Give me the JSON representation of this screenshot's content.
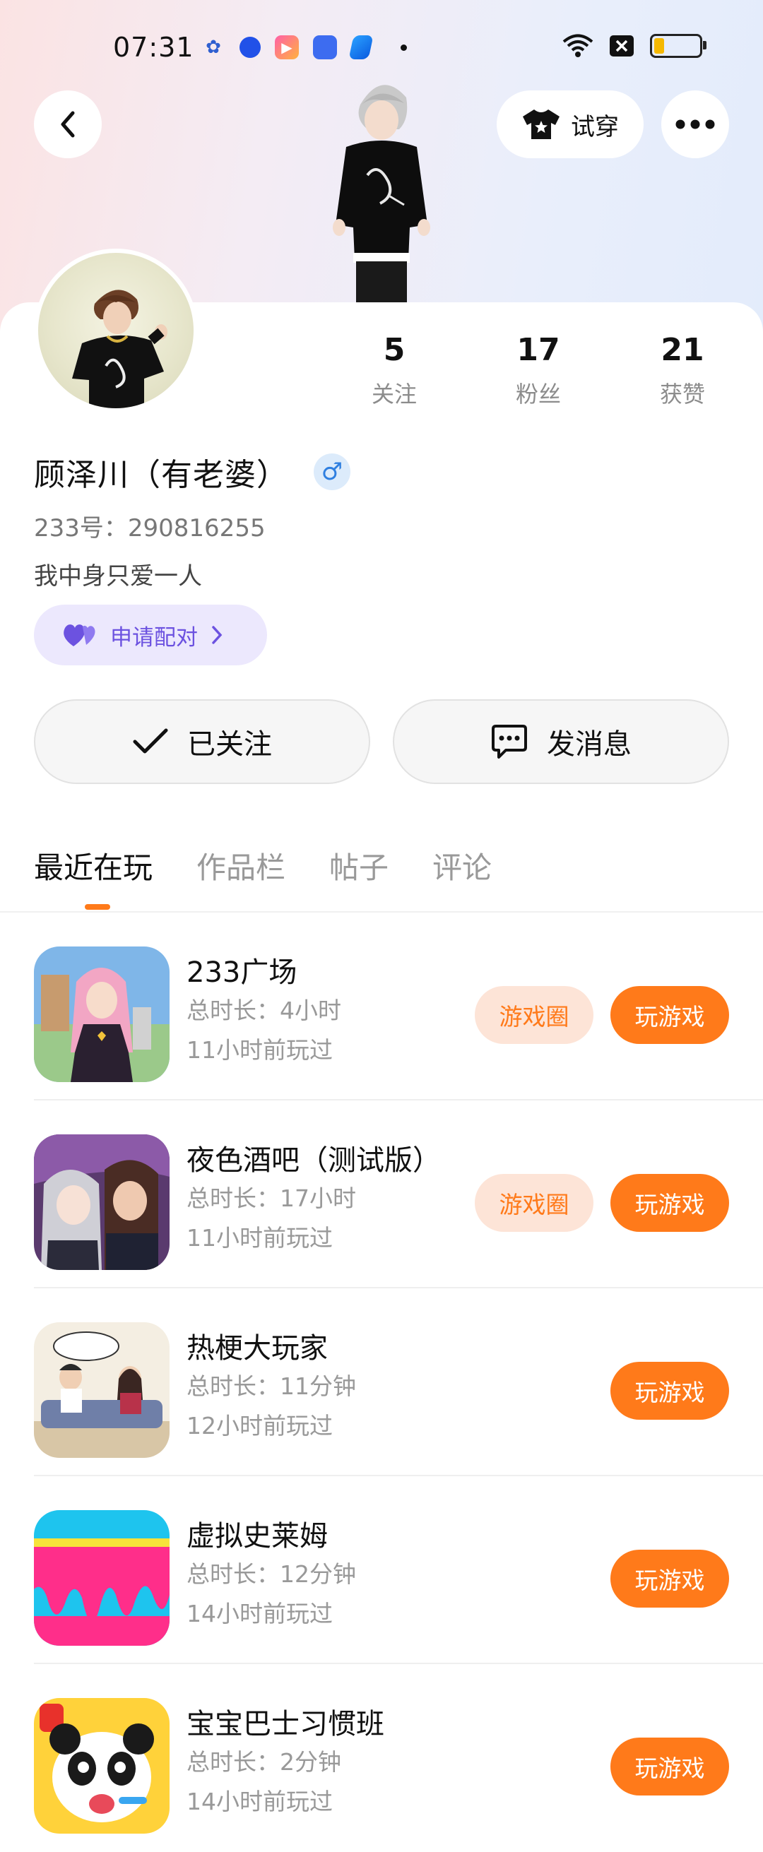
{
  "status_bar": {
    "time": "07:31"
  },
  "top_bar": {
    "try_on_label": "试穿"
  },
  "profile": {
    "stats": [
      {
        "value": "5",
        "label": "关注"
      },
      {
        "value": "17",
        "label": "粉丝"
      },
      {
        "value": "21",
        "label": "获赞"
      }
    ],
    "name": "顾泽川（有老婆）",
    "gender_symbol": "♂",
    "uid_text": "233号：290816255",
    "bio": "我中身只爱一人",
    "match_label": "申请配对",
    "follow_label": "已关注",
    "message_label": "发消息"
  },
  "tabs": [
    {
      "label": "最近在玩",
      "active": true
    },
    {
      "label": "作品栏",
      "active": false
    },
    {
      "label": "帖子",
      "active": false
    },
    {
      "label": "评论",
      "active": false
    }
  ],
  "games": [
    {
      "title": "233广场",
      "duration": "总时长：4小时",
      "last_played": "11小时前玩过",
      "circle_label": "游戏圈",
      "play_label": "玩游戏"
    },
    {
      "title": "夜色酒吧（测试版）",
      "duration": "总时长：17小时",
      "last_played": "11小时前玩过",
      "circle_label": "游戏圈",
      "play_label": "玩游戏"
    },
    {
      "title": "热梗大玩家",
      "duration": "总时长：11分钟",
      "last_played": "12小时前玩过",
      "play_label": "玩游戏"
    },
    {
      "title": "虚拟史莱姆",
      "duration": "总时长：12分钟",
      "last_played": "14小时前玩过",
      "play_label": "玩游戏"
    },
    {
      "title": "宝宝巴士习惯班",
      "duration": "总时长：2分钟",
      "last_played": "14小时前玩过",
      "play_label": "玩游戏"
    }
  ],
  "colors": {
    "accent": "#ff7a1a",
    "accent_soft": "#fde4d7",
    "match_purple": "#6c52e0",
    "gender_blue": "#2f7fe0"
  }
}
